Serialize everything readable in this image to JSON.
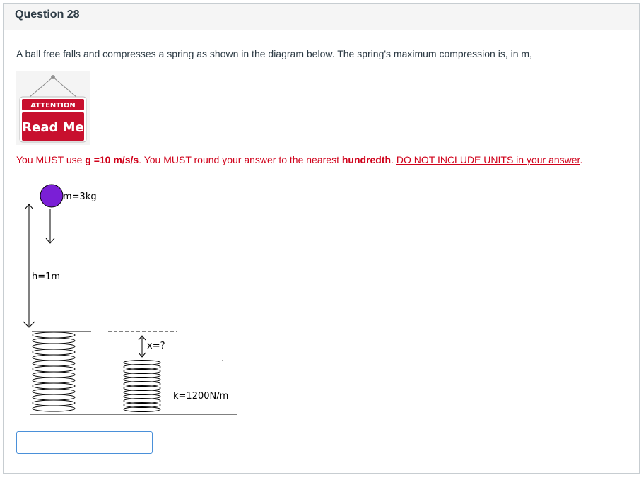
{
  "question": {
    "title": "Question 28",
    "text": "A ball free falls and compresses a spring as shown in the diagram below. The spring's maximum compression is, in m,"
  },
  "attention_sign": {
    "top_text": "ATTENTION",
    "main_text": "Read Me",
    "color": "#c8102e"
  },
  "instructions": {
    "part1": "You MUST use ",
    "g_bold": "g =10 m/s/s",
    "part2": ". You MUST round your answer to the nearest ",
    "hundredth_bold": "hundredth",
    "part3": ". ",
    "underlined": "DO NOT INCLUDE UNITS in your answer",
    "part4": "."
  },
  "diagram": {
    "mass_label": "m=3kg",
    "height_label": "h=1m",
    "compression_label": "x=?",
    "spring_constant_label": "k=1200N/m",
    "ball_color": "#7a1fd6"
  },
  "answer": {
    "value": ""
  }
}
